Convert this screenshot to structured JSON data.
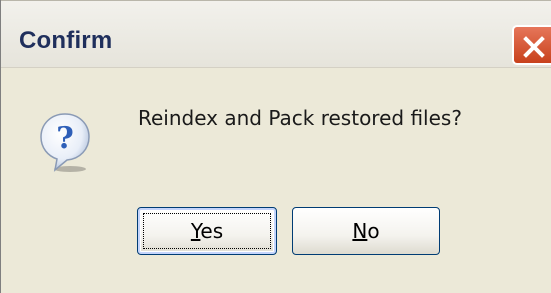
{
  "dialog": {
    "title": "Confirm",
    "message": "Reindex and Pack restored files?"
  },
  "buttons": {
    "yes": {
      "mnemonic": "Y",
      "rest": "es"
    },
    "no": {
      "mnemonic": "N",
      "rest": "o"
    }
  },
  "icons": {
    "close": "close-icon",
    "question": "question-icon"
  },
  "colors": {
    "close_button": "#d4512d",
    "title_text": "#1f2f5c",
    "dialog_background": "#ece9d8",
    "question_icon": "#2e5fb8"
  }
}
